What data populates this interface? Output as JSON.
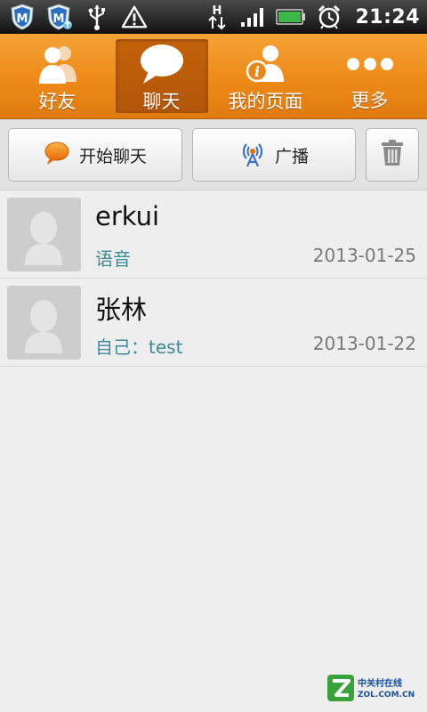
{
  "status_bar": {
    "time": "21:24",
    "icons": [
      "shield-m-icon",
      "shield-m-upload-icon",
      "usb-icon",
      "warning-icon",
      "h-data-icon",
      "signal-icon",
      "battery-icon",
      "alarm-icon"
    ],
    "network_type": "H",
    "battery_color": "#3cb84a"
  },
  "tabs": [
    {
      "label": "好友",
      "icon": "friends-icon",
      "active": false
    },
    {
      "label": "聊天",
      "icon": "chat-bubble-icon",
      "active": true
    },
    {
      "label": "我的页面",
      "icon": "my-page-icon",
      "active": false
    },
    {
      "label": "更多",
      "icon": "more-dots-icon",
      "active": false
    }
  ],
  "toolbar": {
    "start_chat_label": "开始聊天",
    "broadcast_label": "广播",
    "delete_icon": "trash-icon"
  },
  "chats": [
    {
      "name": "erkui",
      "last_message": "语音",
      "date": "2013-01-25"
    },
    {
      "name": "张林",
      "last_message": "自己：test",
      "date": "2013-01-22"
    }
  ],
  "watermark": {
    "cn_text": "中关村在线",
    "en_text": "ZOL.COM.CN"
  },
  "colors": {
    "accent_orange": "#ee8a18",
    "active_tab": "#b8590a",
    "message_preview": "#3c8a9a"
  }
}
